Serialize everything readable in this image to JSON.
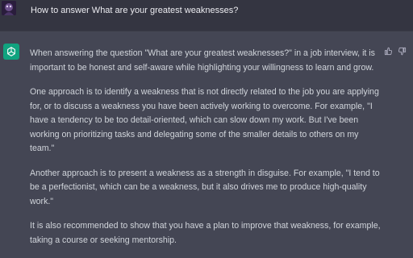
{
  "user_message": {
    "text": "How to answer What are your greatest weaknesses?"
  },
  "assistant_message": {
    "paragraphs": [
      "When answering the question \"What are your greatest weaknesses?\" in a job interview, it is important to be honest and self-aware while highlighting your willingness to learn and grow.",
      "One approach is to identify a weakness that is not directly related to the job you are applying for, or to discuss a weakness you have been actively working to overcome. For example, \"I have a tendency to be too detail-oriented, which can slow down my work. But I've been working on prioritizing tasks and delegating some of the smaller details to others on my team.\"",
      "Another approach is to present a weakness as a strength in disguise. For example, \"I tend to be a perfectionist, which can be a weakness, but it also drives me to produce high-quality work.\"",
      "It is also recommended to show that you have a plan to improve that weakness, for example, taking a course or seeking mentorship."
    ]
  },
  "icons": {
    "user_avatar": "user-avatar-image",
    "assistant_avatar": "openai-logo-icon",
    "thumbs_up": "thumbs-up-icon",
    "thumbs_down": "thumbs-down-icon"
  },
  "colors": {
    "user_bg": "#343541",
    "assistant_bg": "#444654",
    "assistant_avatar_bg": "#10a37f",
    "text": "#d1d5db"
  }
}
